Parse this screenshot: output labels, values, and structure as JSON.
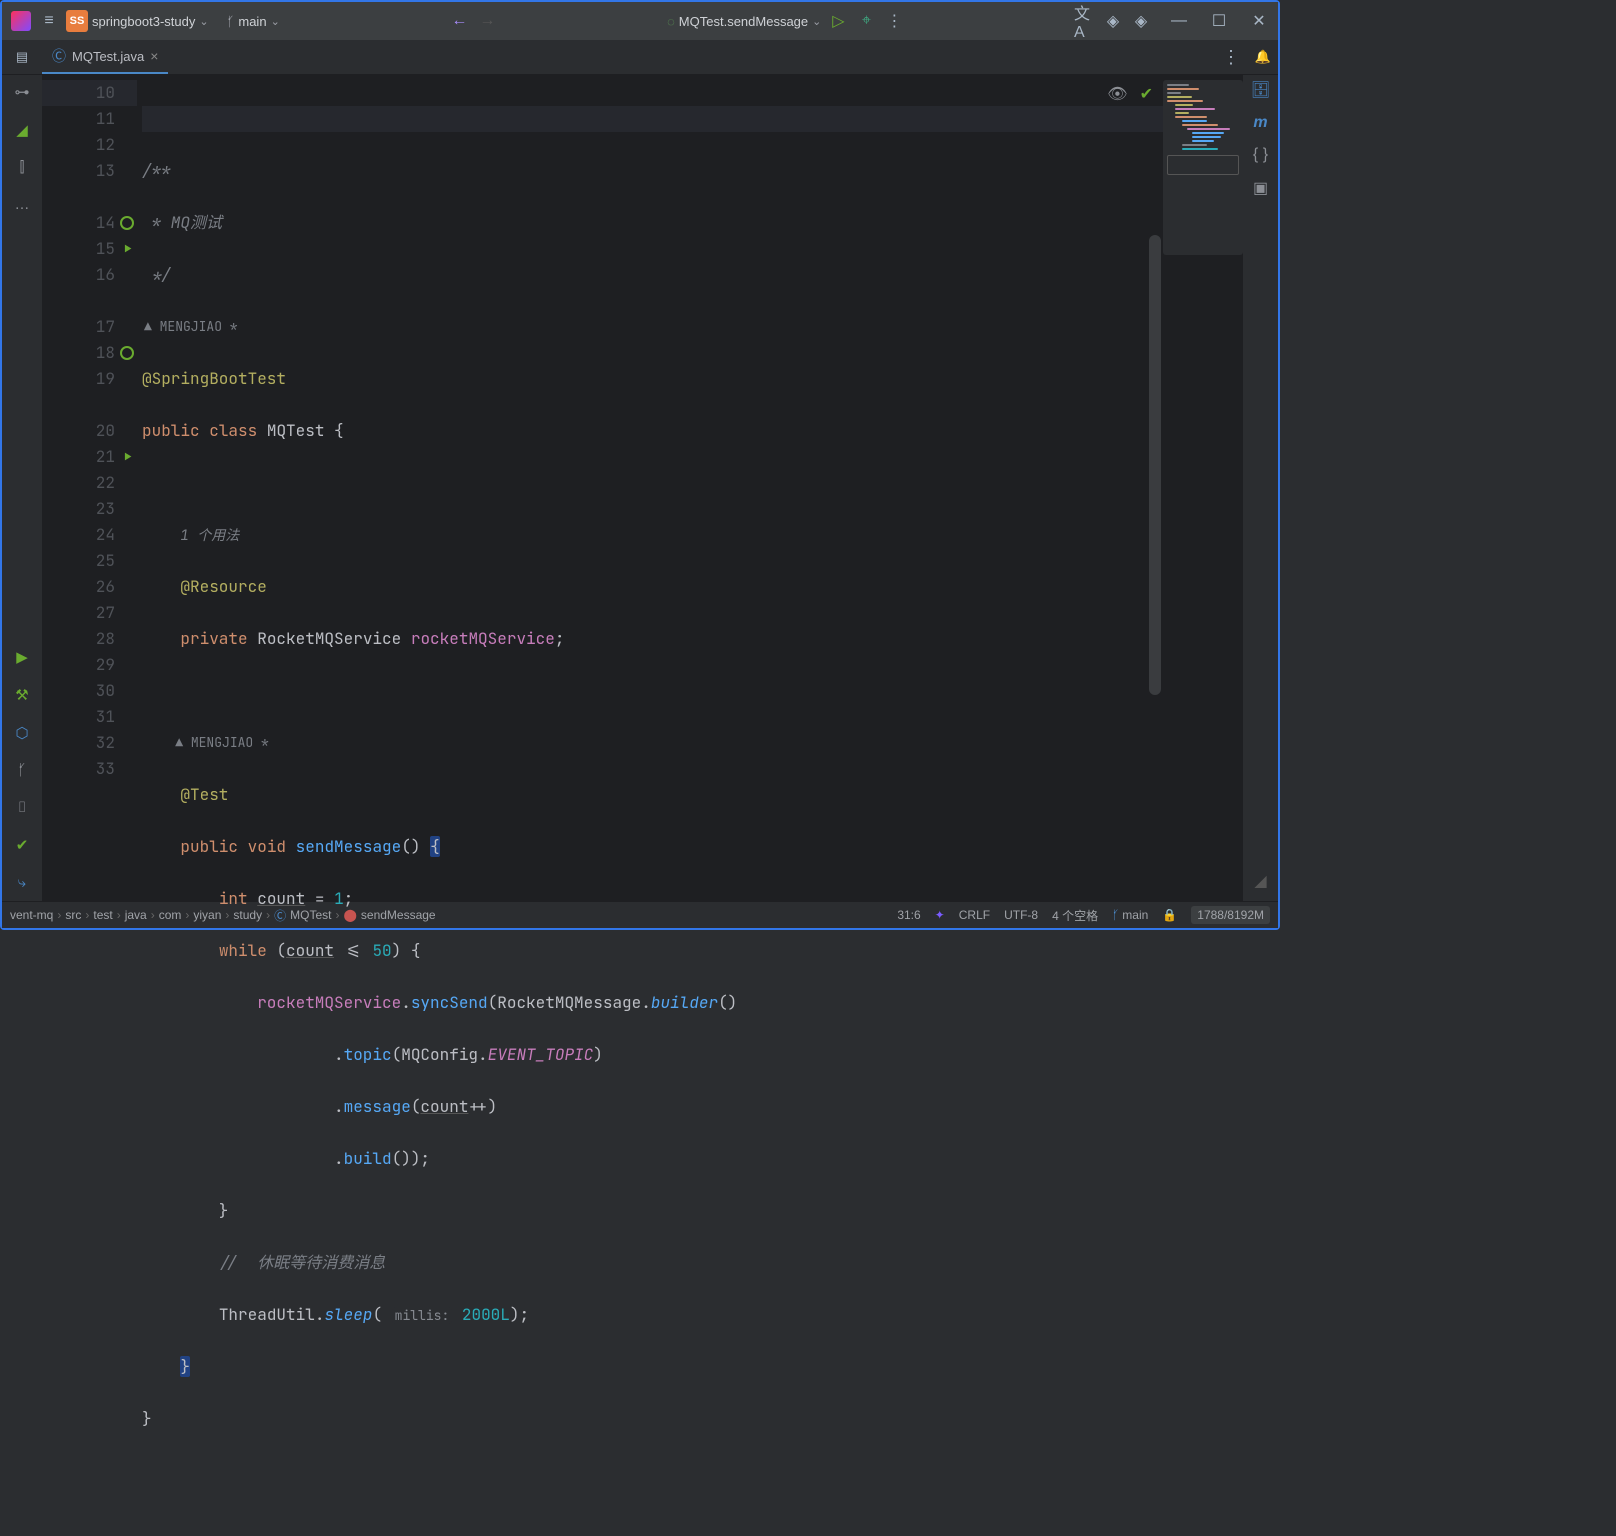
{
  "titlebar": {
    "project": "springboot3-study",
    "branch": "main",
    "run_config": "MQTest.sendMessage"
  },
  "tab": {
    "filename": "MQTest.java"
  },
  "editor": {
    "lines": [
      "10",
      "11",
      "12",
      "13",
      "",
      "14",
      "15",
      "16",
      "",
      "17",
      "18",
      "19",
      "",
      "20",
      "21",
      "22",
      "23",
      "24",
      "25",
      "26",
      "27",
      "28",
      "29",
      "30",
      "31",
      "32",
      "33"
    ],
    "author1": "MENGJIAO *",
    "author2": "MENGJIAO *",
    "usage_hint": "1 个用法",
    "c11": "/**",
    "c12": " * MQ测试",
    "c13": " */",
    "ann_sbt": "@SpringBootTest",
    "kw_public": "public",
    "kw_class": "class",
    "cls_name": "MQTest",
    "ann_res": "@Resource",
    "kw_private": "private",
    "svc_type": "RocketMQService",
    "svc_field": "rocketMQService",
    "ann_test": "@Test",
    "kw_void": "void",
    "mth_send": "sendMessage",
    "kw_int": "int",
    "var_count": "count",
    "lit_1": "1",
    "kw_while": "while",
    "lit_50": "50",
    "mth_sync": "syncSend",
    "cls_msg": "RocketMQMessage",
    "mth_builder": "builder",
    "mth_topic": "topic",
    "cls_cfg": "MQConfig",
    "fld_topic": "EVENT_TOPIC",
    "mth_msg": "message",
    "mth_build": "build",
    "cmt_sleep": "//  休眠等待消费消息",
    "cls_tu": "ThreadUtil",
    "mth_sleep": "sleep",
    "inlay_millis": "millis:",
    "lit_2000": "2000L"
  },
  "breadcrumbs": [
    "vent-mq",
    "src",
    "test",
    "java",
    "com",
    "yiyan",
    "study",
    "MQTest",
    "sendMessage"
  ],
  "status": {
    "pos": "31:6",
    "le": "CRLF",
    "enc": "UTF-8",
    "indent": "4 个空格",
    "branch": "main",
    "mem": "1788/8192M"
  }
}
